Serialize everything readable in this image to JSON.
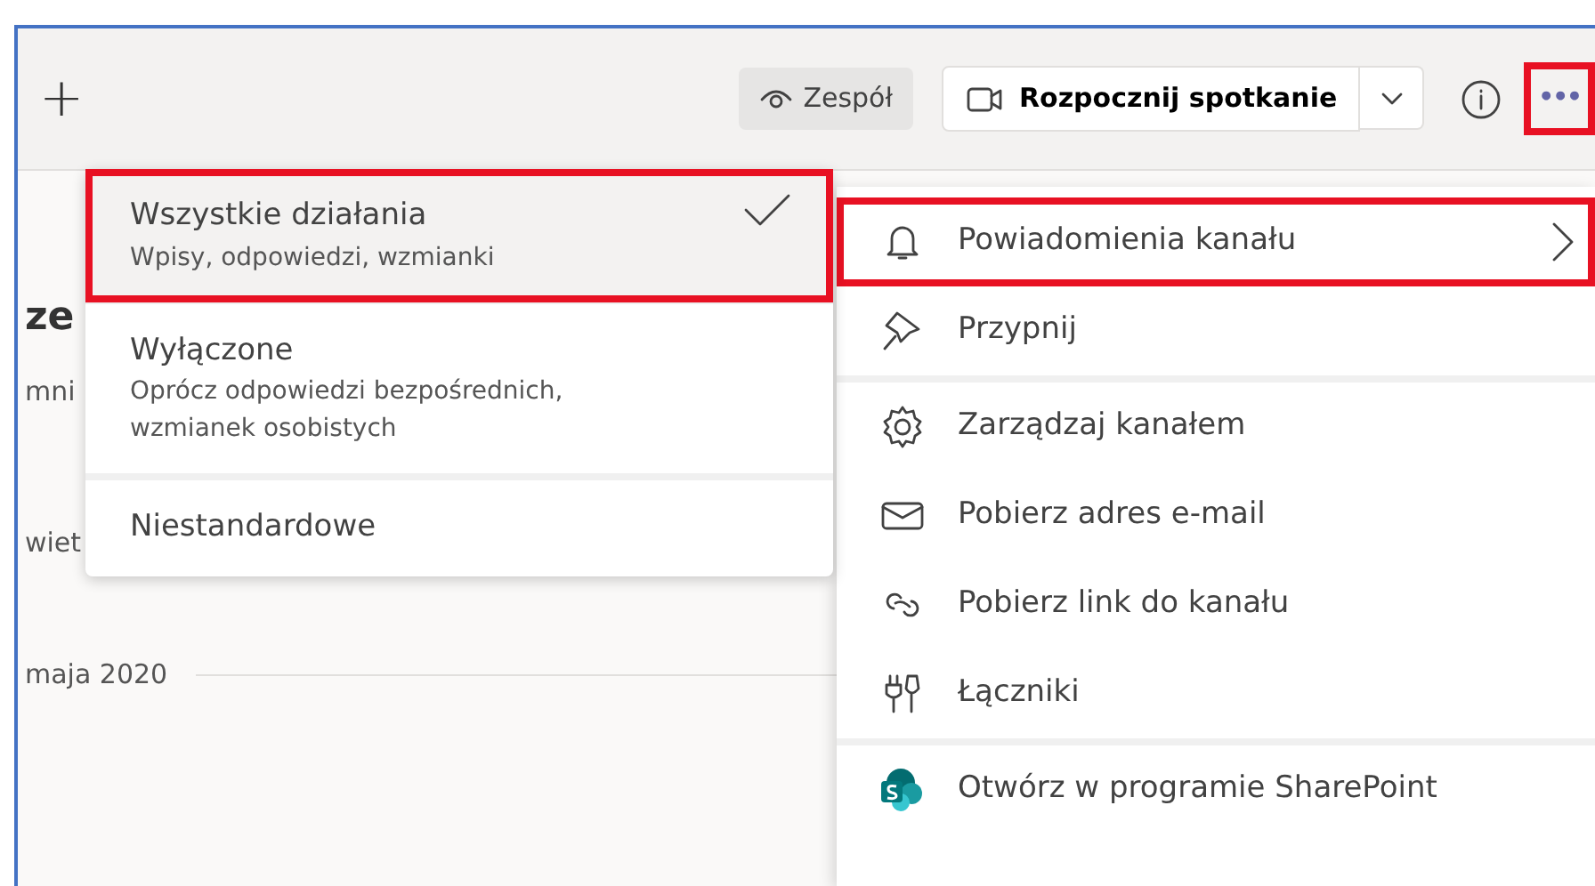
{
  "toolbar": {
    "add_label": "+",
    "team_button": "Zespół",
    "meeting_button": "Rozpocznij spotkanie",
    "more_button": {
      "label": "•••",
      "annotated": true
    }
  },
  "background": {
    "title": "ze",
    "lines": [
      "mni",
      "wiet"
    ],
    "date": "maja 2020"
  },
  "notification_submenu": [
    {
      "label": "Wszystkie działania",
      "description": "Wpisy, odpowiedzi, wzmianki",
      "selected": true,
      "annotated": true
    },
    {
      "label": "Wyłączone",
      "description": "Oprócz odpowiedzi bezpośrednich, wzmianek osobistych",
      "selected": false,
      "annotated": false
    },
    {
      "label": "Niestandardowe",
      "selected": false,
      "annotated": false
    }
  ],
  "channel_menu": {
    "groups": [
      [
        {
          "label": "Powiadomienia kanału",
          "has_submenu": true,
          "annotated": true
        },
        {
          "label": "Przypnij",
          "has_submenu": false,
          "annotated": false
        }
      ],
      [
        {
          "label": "Zarządzaj kanałem",
          "has_submenu": false,
          "annotated": false
        },
        {
          "label": "Pobierz adres e-mail",
          "has_submenu": false,
          "annotated": false
        },
        {
          "label": "Pobierz link do kanału",
          "has_submenu": false,
          "annotated": false
        },
        {
          "label": "Łączniki",
          "has_submenu": false,
          "annotated": false
        }
      ],
      [
        {
          "label": "Otwórz w programie SharePoint",
          "has_submenu": false,
          "annotated": false
        }
      ]
    ]
  }
}
